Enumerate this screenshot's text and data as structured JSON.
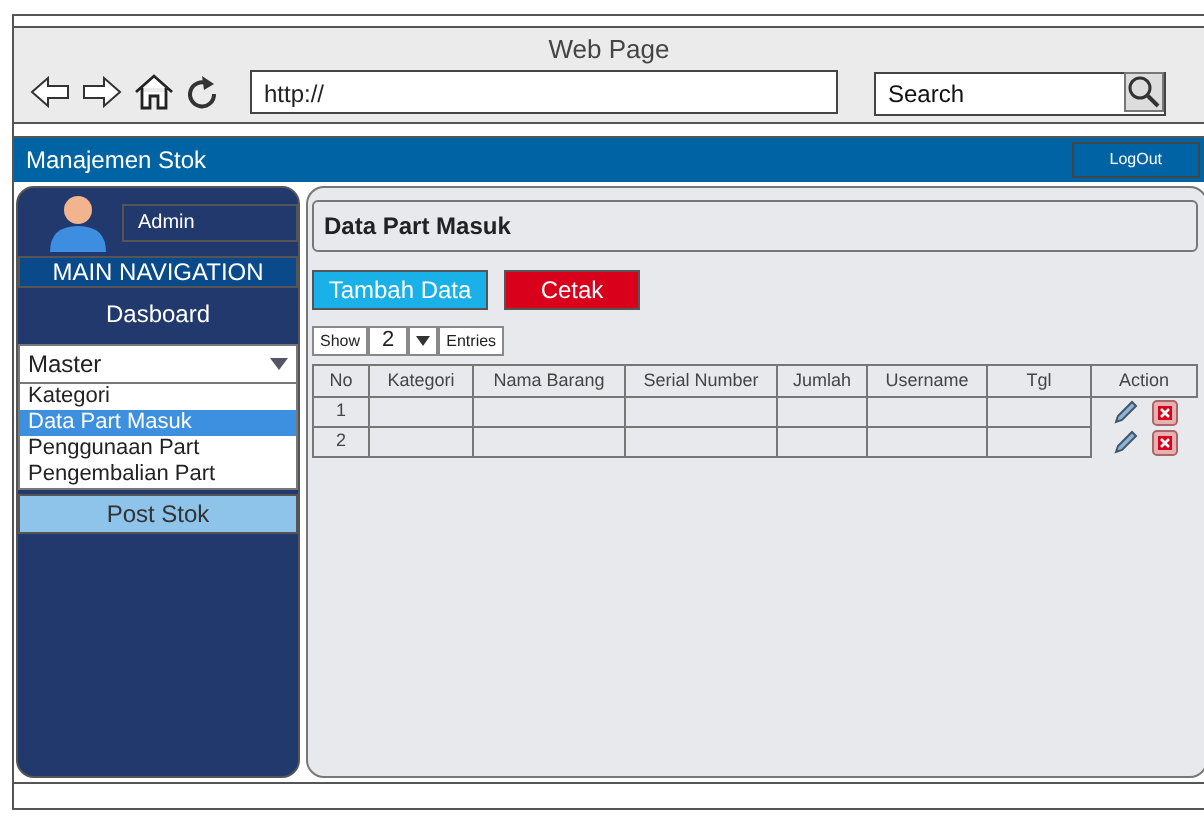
{
  "browser": {
    "title": "Web Page",
    "url": "http://",
    "search_placeholder": "Search"
  },
  "navbar": {
    "brand": "Manajemen Stok",
    "logout": "LogOut"
  },
  "sidebar": {
    "user": "Admin",
    "heading": "MAIN NAVIGATION",
    "dashboard": "Dasboard",
    "dropdown": {
      "label": "Master",
      "expanded": true,
      "items": [
        {
          "label": "Kategori",
          "selected": false
        },
        {
          "label": "Data Part Masuk",
          "selected": true
        },
        {
          "label": "Penggunaan Part",
          "selected": false
        },
        {
          "label": "Pengembalian Part",
          "selected": false
        }
      ]
    },
    "post": "Post Stok"
  },
  "content": {
    "title": "Data Part Masuk",
    "buttons": [
      {
        "label": "Tambah Data",
        "kind": "primary"
      },
      {
        "label": "Cetak",
        "kind": "danger"
      }
    ],
    "show": {
      "label": "Show",
      "value": "2",
      "suffix": "Entries"
    },
    "table": {
      "columns": [
        "No",
        "Kategori",
        "Nama Barang",
        "Serial Number",
        "Jumlah",
        "Username",
        "Tgl",
        "Action"
      ],
      "rows": [
        {
          "no": "1"
        },
        {
          "no": "2"
        }
      ]
    }
  }
}
